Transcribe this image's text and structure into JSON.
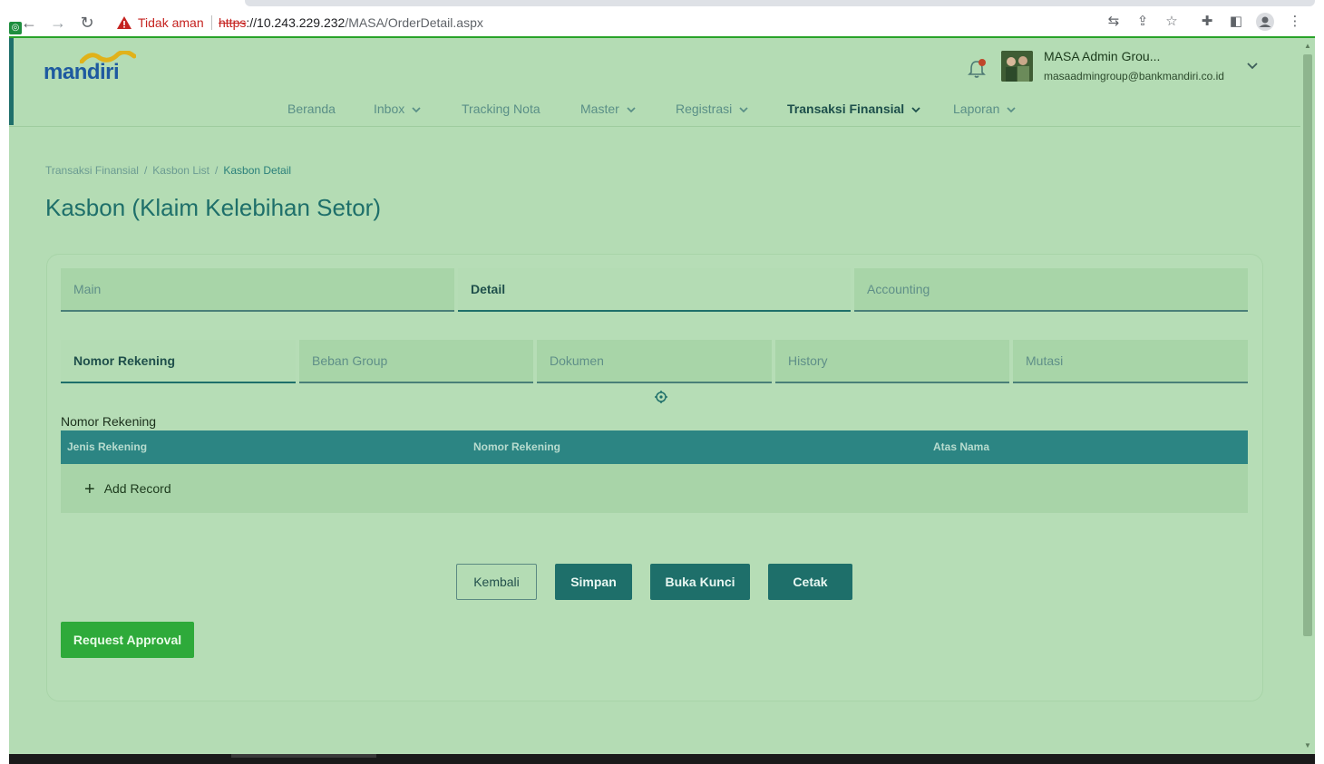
{
  "browser": {
    "security_label": "Tidak aman",
    "url_scheme": "https",
    "url_host": "://10.243.229.232",
    "url_path": "/MASA/OrderDetail.aspx"
  },
  "header": {
    "logo_text": "mandiri",
    "user_name": "MASA Admin Grou...",
    "user_email": "masaadmingroup@bankmandiri.co.id"
  },
  "menu": {
    "items": [
      {
        "label": "Beranda",
        "has_dropdown": false,
        "active": false
      },
      {
        "label": "Inbox",
        "has_dropdown": true,
        "active": false
      },
      {
        "label": "Tracking Nota",
        "has_dropdown": false,
        "active": false
      },
      {
        "label": "Master",
        "has_dropdown": true,
        "active": false
      },
      {
        "label": "Registrasi",
        "has_dropdown": true,
        "active": false
      },
      {
        "label": "Transaksi Finansial",
        "has_dropdown": true,
        "active": true
      },
      {
        "label": "Laporan",
        "has_dropdown": true,
        "active": false
      }
    ]
  },
  "breadcrumb": {
    "items": [
      "Transaksi Finansial",
      "Kasbon List",
      "Kasbon Detail"
    ],
    "separator": "/"
  },
  "page": {
    "title": "Kasbon (Klaim Kelebihan Setor)"
  },
  "tabs": {
    "primary": [
      {
        "label": "Main",
        "active": false
      },
      {
        "label": "Detail",
        "active": true
      },
      {
        "label": "Accounting",
        "active": false
      }
    ],
    "secondary": [
      {
        "label": "Nomor Rekening",
        "active": true
      },
      {
        "label": "Beban Group",
        "active": false
      },
      {
        "label": "Dokumen",
        "active": false
      },
      {
        "label": "History",
        "active": false
      },
      {
        "label": "Mutasi",
        "active": false
      }
    ]
  },
  "section": {
    "label": "Nomor Rekening",
    "columns": [
      "Jenis Rekening",
      "Nomor Rekening",
      "Atas Nama"
    ],
    "add_record_label": "Add Record"
  },
  "actions": {
    "kembali": "Kembali",
    "simpan": "Simpan",
    "buka_kunci": "Buka Kunci",
    "cetak": "Cetak",
    "request_approval": "Request Approval"
  },
  "colors": {
    "page_bg": "#b4dcb4",
    "primary": "#1e6f6a",
    "table_header": "#2c8583",
    "approval_green": "#2eaa3a",
    "insecure_red": "#c5221f"
  }
}
